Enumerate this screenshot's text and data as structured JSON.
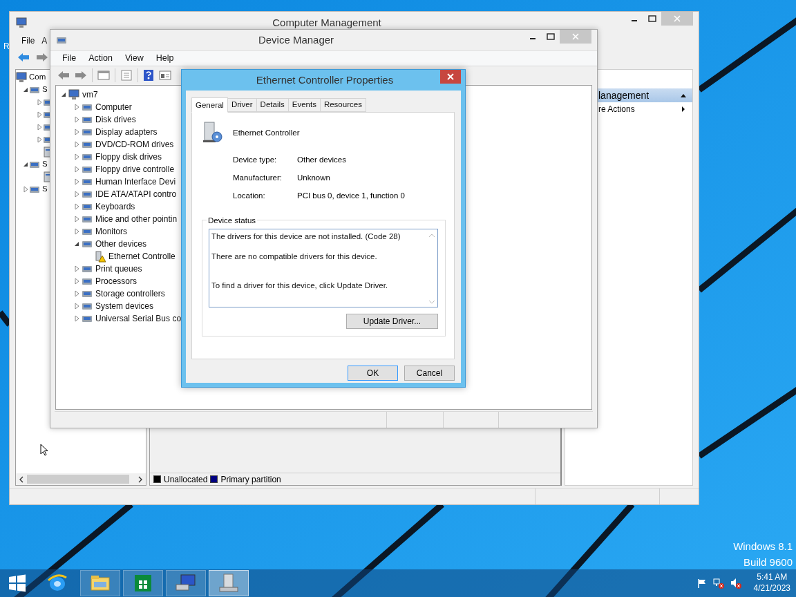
{
  "desktop": {
    "icon_label": "R",
    "os_lines": [
      "Windows 8.1",
      "Build 9600"
    ]
  },
  "computer_management": {
    "title": "Computer Management",
    "menu": [
      "File",
      "A"
    ],
    "tree": [
      {
        "label": "Com",
        "children": [
          {
            "label": "S",
            "expanded": true,
            "children": [
              {
                "expanded": false
              },
              {
                "expanded": false
              },
              {
                "expanded": false
              },
              {
                "expanded": false
              },
              {
                "kind": "leaf"
              }
            ]
          },
          {
            "label": "S",
            "expanded": true,
            "children": [
              {
                "kind": "leaf"
              }
            ]
          },
          {
            "label": "S",
            "expanded": false
          }
        ]
      }
    ],
    "actions": {
      "header": "lanagement",
      "items": [
        "re Actions"
      ]
    },
    "legend": [
      {
        "label": "Unallocated",
        "color": "#000000"
      },
      {
        "label": "Primary partition",
        "color": "#000080"
      }
    ]
  },
  "device_manager": {
    "title": "Device Manager",
    "menu": [
      "File",
      "Action",
      "View",
      "Help"
    ],
    "tree": [
      {
        "label": "vm7",
        "expanded": true,
        "children": [
          {
            "label": "Computer",
            "expanded": false
          },
          {
            "label": "Disk drives",
            "expanded": false
          },
          {
            "label": "Display adapters",
            "expanded": false
          },
          {
            "label": "DVD/CD-ROM drives",
            "expanded": false
          },
          {
            "label": "Floppy disk drives",
            "expanded": false
          },
          {
            "label": "Floppy drive controlle",
            "expanded": false
          },
          {
            "label": "Human Interface Devi",
            "expanded": false
          },
          {
            "label": "IDE ATA/ATAPI contro",
            "expanded": false
          },
          {
            "label": "Keyboards",
            "expanded": false
          },
          {
            "label": "Mice and other pointin",
            "expanded": false
          },
          {
            "label": "Monitors",
            "expanded": false
          },
          {
            "label": "Other devices",
            "expanded": true,
            "children": [
              {
                "label": "Ethernet Controlle",
                "warning": true
              }
            ]
          },
          {
            "label": "Print queues",
            "expanded": false
          },
          {
            "label": "Processors",
            "expanded": false
          },
          {
            "label": "Storage controllers",
            "expanded": false
          },
          {
            "label": "System devices",
            "expanded": false
          },
          {
            "label": "Universal Serial Bus co",
            "expanded": false
          }
        ]
      }
    ]
  },
  "dialog": {
    "title": "Ethernet Controller Properties",
    "tabs": [
      {
        "label": "General",
        "selected": true
      },
      {
        "label": "Driver",
        "selected": false
      },
      {
        "label": "Details",
        "selected": false
      },
      {
        "label": "Events",
        "selected": false
      },
      {
        "label": "Resources",
        "selected": false
      }
    ],
    "device_name": "Ethernet Controller",
    "properties": [
      {
        "label": "Device type:",
        "value": "Other devices"
      },
      {
        "label": "Manufacturer:",
        "value": "Unknown"
      },
      {
        "label": "Location:",
        "value": "PCI bus 0, device 1, function 0"
      }
    ],
    "status_group": "Device status",
    "status_lines": [
      "The drivers for this device are not installed. (Code 28)",
      "There are no compatible drivers for this device.",
      "To find a driver for this device, click Update Driver."
    ],
    "update_button": "Update Driver...",
    "buttons": [
      {
        "label": "OK",
        "default": true
      },
      {
        "label": "Cancel",
        "default": false
      }
    ]
  },
  "taskbar": {
    "apps": [
      {
        "kind": "ie",
        "running": false,
        "selected": false
      },
      {
        "kind": "explorer",
        "running": true,
        "selected": false
      },
      {
        "kind": "store",
        "running": true,
        "selected": false
      },
      {
        "kind": "computer",
        "running": true,
        "selected": false
      },
      {
        "kind": "device",
        "running": true,
        "selected": true
      }
    ],
    "time": "5:41 AM",
    "date": "4/21/2023"
  }
}
